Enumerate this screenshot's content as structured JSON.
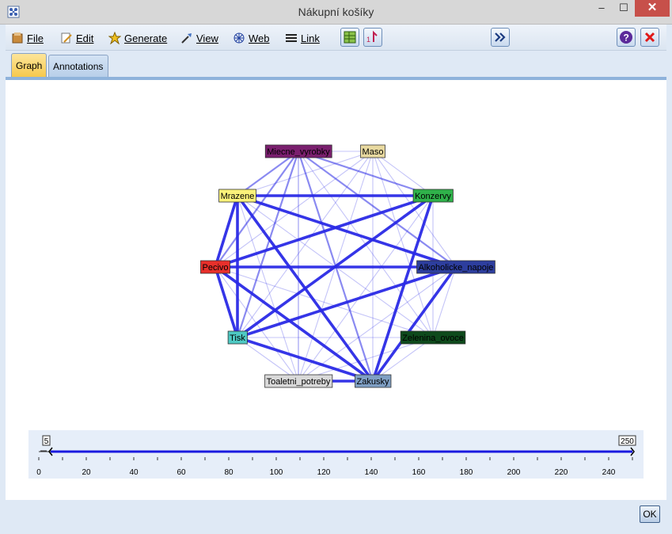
{
  "window": {
    "title": "Nákupní košíky",
    "minimize": "–",
    "maximize": "☐",
    "close": "✕"
  },
  "menu": [
    {
      "id": "file",
      "label": "File",
      "icon": "file-icon"
    },
    {
      "id": "edit",
      "label": "Edit",
      "icon": "edit-icon"
    },
    {
      "id": "generate",
      "label": "Generate",
      "icon": "generate-icon"
    },
    {
      "id": "view",
      "label": "View",
      "icon": "view-icon"
    },
    {
      "id": "web",
      "label": "Web",
      "icon": "web-icon"
    },
    {
      "id": "link",
      "label": "Link",
      "icon": "link-icon"
    }
  ],
  "tabs": {
    "graph": "Graph",
    "annotations": "Annotations"
  },
  "graph": {
    "edge_color": "#2a2ae6",
    "nodes": [
      {
        "id": "miecne",
        "label": "Miecne_vyrobky",
        "bg": "#7a1f6e",
        "fg": "#000000"
      },
      {
        "id": "maso",
        "label": "Maso",
        "bg": "#e8d9a0",
        "fg": "#000000"
      },
      {
        "id": "mrazene",
        "label": "Mrazene",
        "bg": "#fbf27a",
        "fg": "#000000"
      },
      {
        "id": "konzervy",
        "label": "Konzervy",
        "bg": "#2fb14a",
        "fg": "#000000"
      },
      {
        "id": "pecivo",
        "label": "Pecivo",
        "bg": "#e8302b",
        "fg": "#000000"
      },
      {
        "id": "alkoholicke",
        "label": "Alkoholicke_napoje",
        "bg": "#2d3e9e",
        "fg": "#000000"
      },
      {
        "id": "tisk",
        "label": "Tisk",
        "bg": "#4ec9c3",
        "fg": "#000000"
      },
      {
        "id": "zelenina",
        "label": "Zelenina_ovoce",
        "bg": "#0e4a1c",
        "fg": "#000000"
      },
      {
        "id": "toaletni",
        "label": "Toaletni_potreby",
        "bg": "#d9d9d9",
        "fg": "#000000"
      },
      {
        "id": "zakusky",
        "label": "Zakusky",
        "bg": "#7f9fc4",
        "fg": "#000000"
      }
    ],
    "edges": [
      [
        "mrazene",
        "konzervy",
        3
      ],
      [
        "mrazene",
        "alkoholicke",
        3
      ],
      [
        "mrazene",
        "pecivo",
        3
      ],
      [
        "mrazene",
        "tisk",
        3
      ],
      [
        "mrazene",
        "zakusky",
        3
      ],
      [
        "pecivo",
        "konzervy",
        3
      ],
      [
        "pecivo",
        "alkoholicke",
        3
      ],
      [
        "pecivo",
        "tisk",
        3
      ],
      [
        "pecivo",
        "zakusky",
        3
      ],
      [
        "tisk",
        "konzervy",
        3
      ],
      [
        "tisk",
        "alkoholicke",
        3
      ],
      [
        "tisk",
        "zakusky",
        3
      ],
      [
        "konzervy",
        "zakusky",
        3
      ],
      [
        "alkoholicke",
        "zakusky",
        3
      ],
      [
        "zakusky",
        "toaletni",
        3
      ],
      [
        "miecne",
        "tisk",
        2
      ],
      [
        "miecne",
        "pecivo",
        2
      ],
      [
        "miecne",
        "zakusky",
        2
      ],
      [
        "miecne",
        "alkoholicke",
        2
      ],
      [
        "miecne",
        "konzervy",
        2
      ],
      [
        "miecne",
        "mrazene",
        2
      ],
      [
        "mrazene",
        "zelenina",
        1
      ],
      [
        "konzervy",
        "zelenina",
        1
      ],
      [
        "pecivo",
        "zelenina",
        1
      ],
      [
        "tisk",
        "zelenina",
        1
      ],
      [
        "alkoholicke",
        "zelenina",
        1
      ],
      [
        "zelenina",
        "zakusky",
        1
      ],
      [
        "zelenina",
        "toaletni",
        1
      ],
      [
        "toaletni",
        "mrazene",
        1
      ],
      [
        "toaletni",
        "konzervy",
        1
      ],
      [
        "toaletni",
        "alkoholicke",
        1
      ],
      [
        "toaletni",
        "pecivo",
        1
      ],
      [
        "toaletni",
        "tisk",
        1
      ],
      [
        "toaletni",
        "miecne",
        1
      ],
      [
        "maso",
        "mrazene",
        1
      ],
      [
        "maso",
        "konzervy",
        1
      ],
      [
        "maso",
        "alkoholicke",
        1
      ],
      [
        "maso",
        "zakusky",
        1
      ],
      [
        "maso",
        "zelenina",
        1
      ],
      [
        "maso",
        "tisk",
        1
      ],
      [
        "maso",
        "pecivo",
        1
      ],
      [
        "maso",
        "toaletni",
        1
      ],
      [
        "maso",
        "miecne",
        1
      ],
      [
        "miecne",
        "zelenina",
        1
      ],
      [
        "miecne",
        "toaletni",
        1
      ]
    ]
  },
  "slider": {
    "min_value": "5",
    "max_value": "250",
    "ticks": [
      "0",
      "20",
      "40",
      "60",
      "80",
      "100",
      "120",
      "140",
      "160",
      "180",
      "200",
      "220",
      "240"
    ]
  },
  "ok_button": "OK"
}
